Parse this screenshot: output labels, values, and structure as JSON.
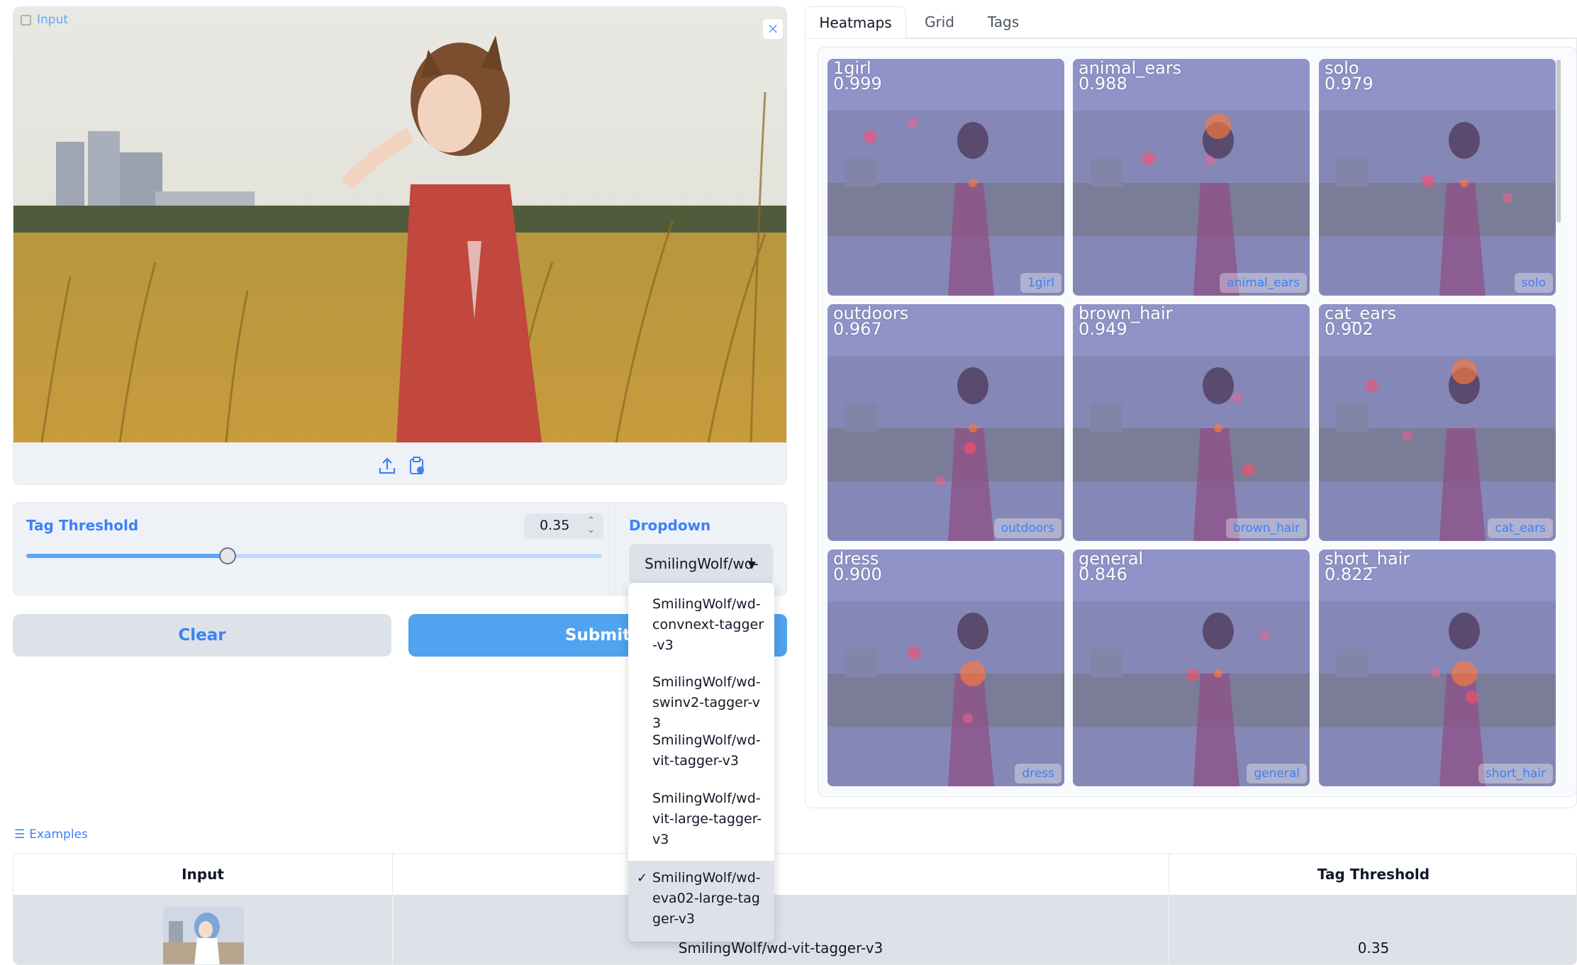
{
  "input": {
    "label": "Input",
    "close": "×"
  },
  "controls": {
    "threshold_label": "Tag Threshold",
    "threshold_value": "0.35",
    "threshold_fraction": 0.35,
    "dropdown_label": "Dropdown",
    "dropdown_value": "SmilingWolf/wd-"
  },
  "buttons": {
    "clear": "Clear",
    "submit": "Submit"
  },
  "dropdown_menu": {
    "options": [
      {
        "label": "SmilingWolf/wd-convnext-tagger-v3",
        "selected": false
      },
      {
        "label": "SmilingWolf/wd-swinv2-tagger-v3",
        "selected": false
      },
      {
        "label": "SmilingWolf/wd-vit-tagger-v3",
        "selected": false
      },
      {
        "label": "SmilingWolf/wd-vit-large-tagger-v3",
        "selected": false
      },
      {
        "label": "SmilingWolf/wd-eva02-large-tagger-v3",
        "selected": true
      }
    ],
    "check_mark": "✓"
  },
  "tabs": [
    "Heatmaps",
    "Grid",
    "Tags"
  ],
  "heatmaps": [
    {
      "tag": "1girl",
      "score": "0.999"
    },
    {
      "tag": "animal_ears",
      "score": "0.988"
    },
    {
      "tag": "solo",
      "score": "0.979"
    },
    {
      "tag": "outdoors",
      "score": "0.967"
    },
    {
      "tag": "brown_hair",
      "score": "0.949"
    },
    {
      "tag": "cat_ears",
      "score": "0.902"
    },
    {
      "tag": "dress",
      "score": "0.900"
    },
    {
      "tag": "general",
      "score": "0.846"
    },
    {
      "tag": "short_hair",
      "score": "0.822"
    }
  ],
  "examples": {
    "label": "Examples",
    "headers": [
      "Input",
      "",
      "Tag Threshold"
    ],
    "row": {
      "model": "SmilingWolf/wd-vit-tagger-v3",
      "threshold": "0.35"
    }
  },
  "colors": {
    "accent": "#3b82f6",
    "submit": "#4fa3ef",
    "panel": "#eef2f7",
    "heatmap_overlay": "#9093c8"
  }
}
